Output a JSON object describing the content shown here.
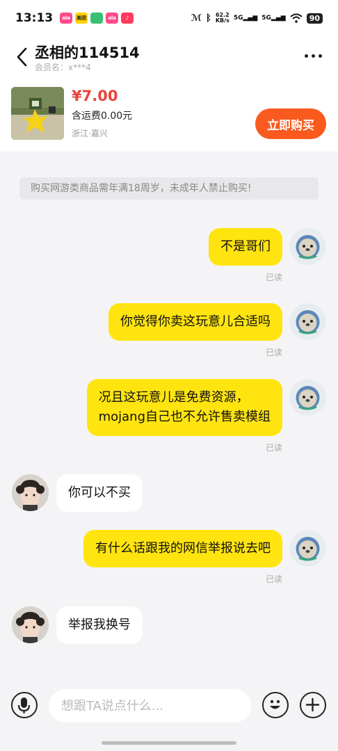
{
  "status_bar": {
    "time": "13:13",
    "app_icons": [
      {
        "name": "app-icon-1",
        "label": "ala",
        "color": "#ff4a8a"
      },
      {
        "name": "app-icon-2",
        "label": "美团",
        "color": "#ffd100"
      },
      {
        "name": "app-icon-3",
        "label": "",
        "color": "#38c172"
      },
      {
        "name": "app-icon-4",
        "label": "ala",
        "color": "#ff4a8a"
      },
      {
        "name": "app-icon-5",
        "label": "♪",
        "color": "#ff3b5c"
      }
    ],
    "net_speed_value": "62.2",
    "net_speed_unit": "KB/s",
    "sig1": "5G",
    "sig2": "5G",
    "battery": "90"
  },
  "header": {
    "title": "丞相的114514",
    "subtitle": "会员名：x***4"
  },
  "product": {
    "price": "¥7.00",
    "shipping": "含运费0.00元",
    "location": "浙江·嘉兴",
    "buy_label": "立即购买"
  },
  "notice": "购买网游类商品需年满18周岁，未成年人禁止购买!",
  "messages": [
    {
      "from": "me",
      "text": "不是哥们",
      "read": "已读"
    },
    {
      "from": "me",
      "text": "你觉得你卖这玩意儿合适吗",
      "read": "已读"
    },
    {
      "from": "me",
      "text_line1": "况且这玩意儿是免费资源，",
      "text_line2": "mojang自己也不允许售卖模组",
      "read": "已读"
    },
    {
      "from": "them",
      "text": "你可以不买"
    },
    {
      "from": "me",
      "text": "有什么话跟我的网信举报说去吧",
      "read": "已读"
    },
    {
      "from": "them",
      "text": "举报我换号"
    }
  ],
  "input": {
    "placeholder": "想跟TA说点什么..."
  },
  "colors": {
    "my_bubble": "#ffe40f",
    "their_bubble": "#ffffff",
    "price": "#e8443a",
    "buy_button": "#fb5a1e"
  }
}
